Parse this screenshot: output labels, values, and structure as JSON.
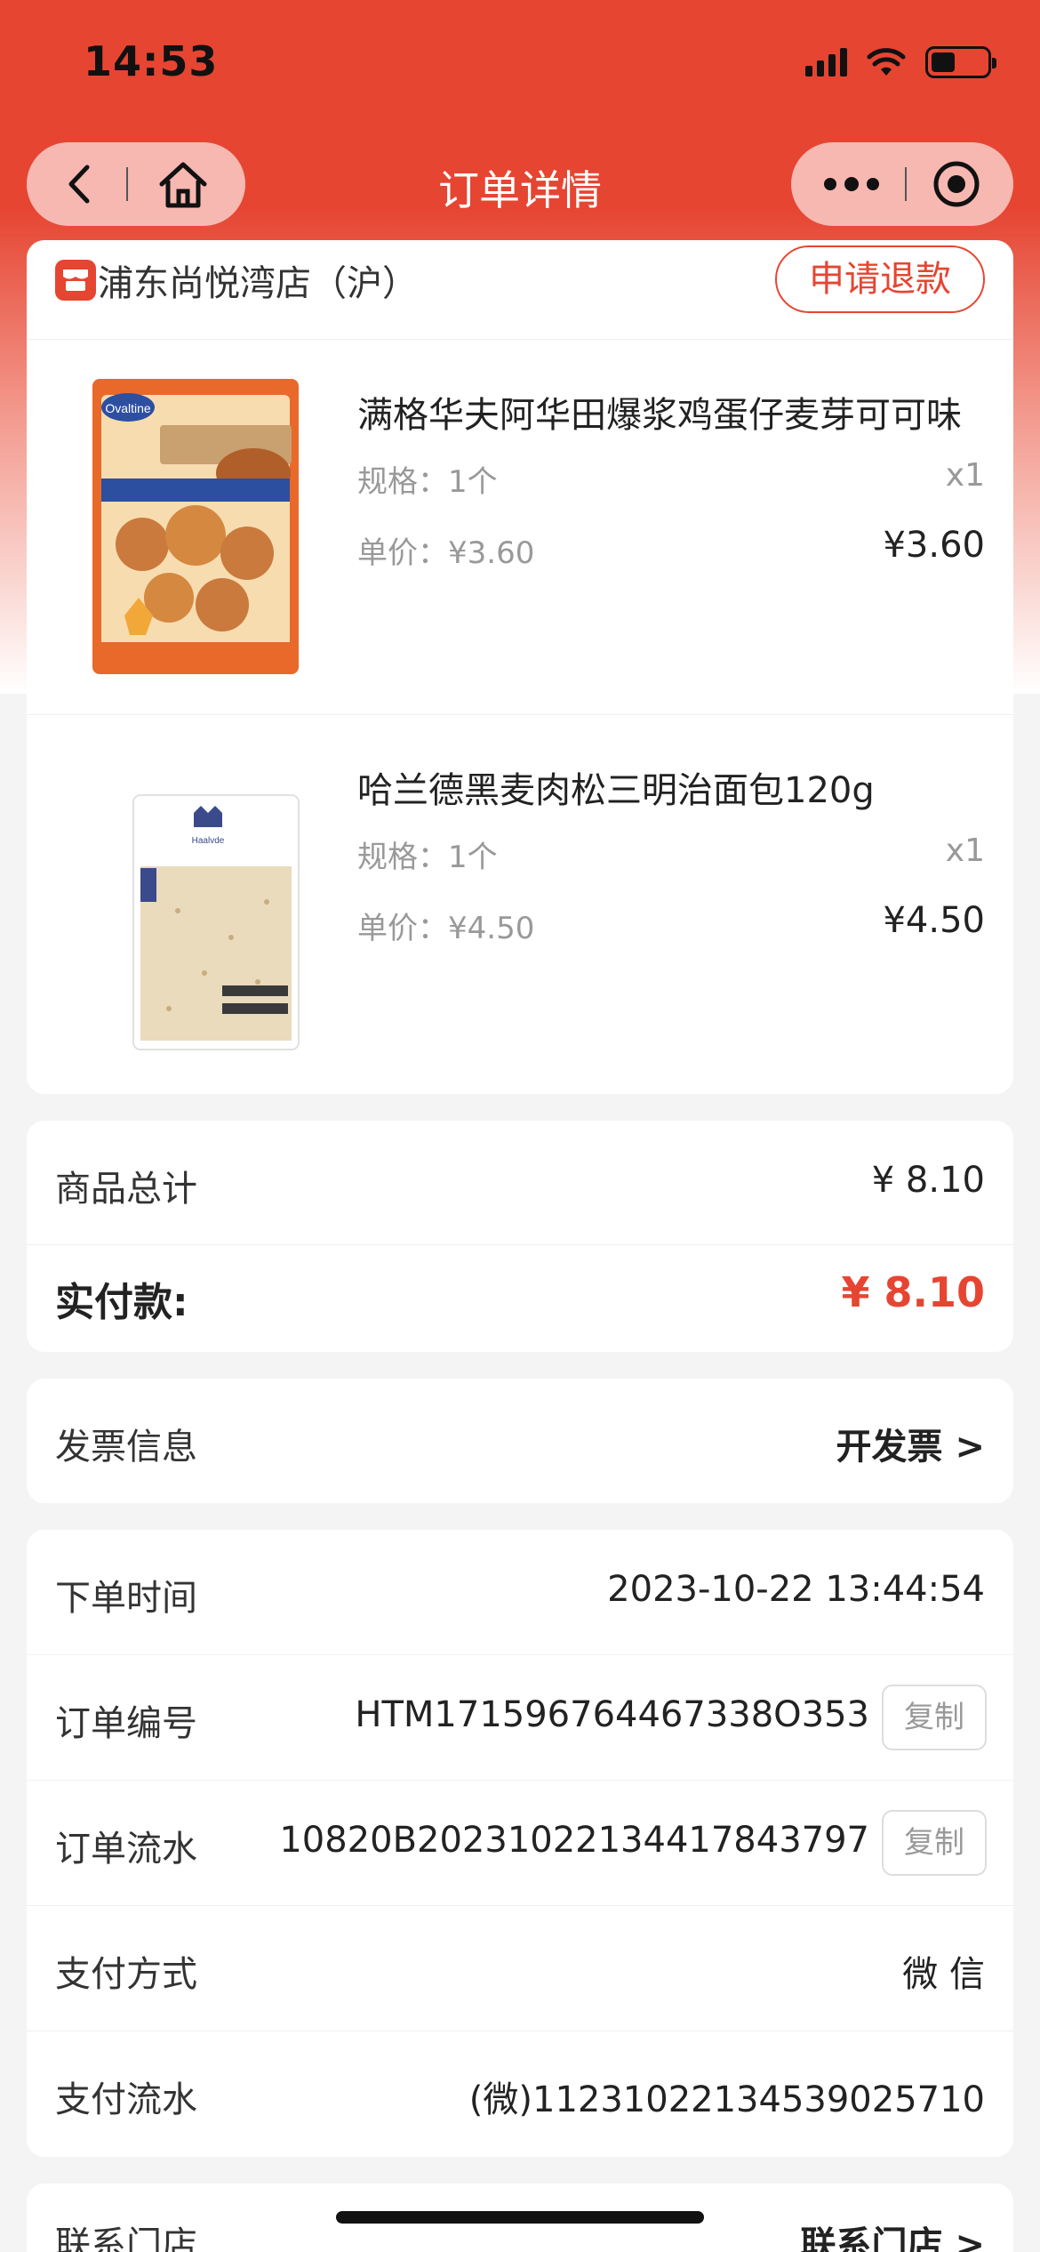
{
  "status_bar": {
    "time": "14:53"
  },
  "nav": {
    "title": "订单详情"
  },
  "store": {
    "name": "浦东尚悦湾店（沪）",
    "refund_label": "申请退款"
  },
  "products": [
    {
      "name": "满格华夫阿华田爆浆鸡蛋仔麦芽可可味",
      "spec": "规格：1个",
      "qty": "x1",
      "unit_price": "单价：¥3.60",
      "price": "¥3.60"
    },
    {
      "name": "哈兰德黑麦肉松三明治面包120g",
      "spec": "规格：1个",
      "qty": "x1",
      "unit_price": "单价：¥4.50",
      "price": "¥4.50"
    }
  ],
  "totals": {
    "subtotal_label": "商品总计",
    "subtotal_value": "¥ 8.10",
    "paid_label": "实付款:",
    "paid_value": "¥ 8.10"
  },
  "invoice": {
    "label": "发票信息",
    "action": "开发票 >"
  },
  "order_info": {
    "time_label": "下单时间",
    "time_value": "2023-10-22 13:44:54",
    "number_label": "订单编号",
    "number_value": "HTM171596764467338O353",
    "flow_label": "订单流水",
    "flow_value": "10820B20231022134417843797",
    "pay_method_label": "支付方式",
    "pay_method_value": "微 信",
    "pay_flow_label": "支付流水",
    "pay_flow_value": "(微)112310221345390257​10",
    "copy_label": "复制"
  },
  "contact": {
    "label": "联系门店",
    "action": "联系门店 >"
  },
  "colors": {
    "accent": "#e64532"
  }
}
